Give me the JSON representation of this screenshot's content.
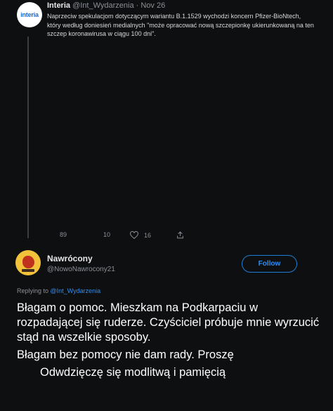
{
  "quoted_tweet": {
    "avatar_text": "interia",
    "name": "Interia",
    "handle": "@Int_Wydarzenia",
    "separator": " · ",
    "date": "Nov 26",
    "body": "Naprzeciw spekulacjom dotyczącym wariantu B.1.1529 wychodzi koncern Pfizer-BioNtech, który według doniesień medialnych \"może opracować nową szczepionkę ukierunkowaną na ten szczep koronawirusa w ciągu 100 dni\".",
    "more_glyph": "",
    "actions": {
      "reply_icon": "",
      "reply_count": "89",
      "retweet_icon": "",
      "retweet_count": "10",
      "like_count": "16"
    }
  },
  "reply_tweet": {
    "name": "Nawrócony",
    "handle": "@NowoNawrocony21",
    "follow_label": "Follow",
    "more_glyph": "",
    "replying_to_prefix": "Replying to ",
    "replying_to_handle": "@Int_Wydarzenia",
    "text_lines": [
      "Błagam o pomoc. Mieszkam na Podkarpaciu w rozpadającej się ruderze. Czyściciel próbuje mnie wyrzucić stąd na wszelkie sposoby.",
      "Błagam bez pomocy nie dam rady. Proszę",
      "Odwdzięczę się modlitwą i pamięcią"
    ]
  },
  "colors": {
    "background": "#0e0f11",
    "accent": "#1d9bf0",
    "muted": "#8b9096"
  }
}
